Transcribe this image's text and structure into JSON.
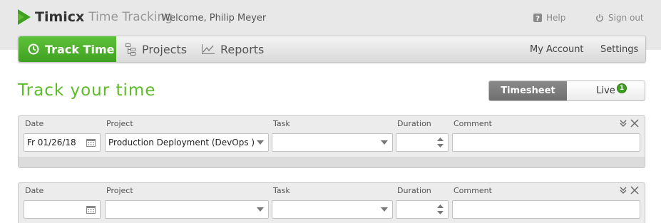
{
  "header": {
    "brand_name": "Timicx",
    "brand_sub": "Time Tracking",
    "welcome": "Welcome, Philip Meyer",
    "help": "Help",
    "sign_out": "Sign out"
  },
  "nav": {
    "track_time": "Track Time",
    "projects": "Projects",
    "reports": "Reports",
    "my_account": "My Account",
    "settings": "Settings"
  },
  "page": {
    "title": "Track your time"
  },
  "view_toggle": {
    "timesheet": "Timesheet",
    "live": "Live",
    "live_count": "1"
  },
  "labels": {
    "date": "Date",
    "project": "Project",
    "task": "Task",
    "duration": "Duration",
    "comment": "Comment"
  },
  "entries": [
    {
      "date": "Fr 01/26/18",
      "project": "Production Deployment (DevOps )",
      "task": "",
      "duration": "",
      "comment": ""
    },
    {
      "date": "",
      "project": "",
      "task": "",
      "duration": "",
      "comment": ""
    }
  ],
  "colors": {
    "accent_green": "#5dbb2a",
    "nav_active": "#4aad2c",
    "toggle_active": "#7d7d7d"
  },
  "icons": [
    "logo-mark-icon",
    "help-icon",
    "power-icon",
    "clock-icon",
    "projects-tree-icon",
    "reports-chart-icon",
    "calendar-icon",
    "dropdown-arrow-icon",
    "spinner-icon",
    "collapse-icon",
    "close-icon"
  ]
}
